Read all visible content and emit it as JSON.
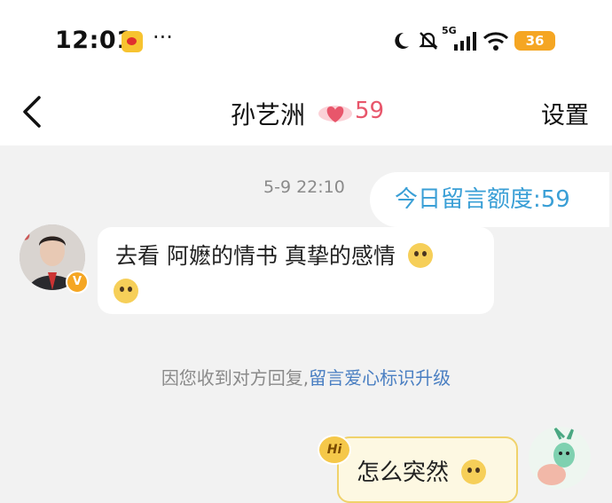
{
  "status_bar": {
    "time": "12:01",
    "more": "···",
    "network": "5G",
    "battery": "36",
    "icons": [
      "weibo-icon",
      "moon-icon",
      "mute-icon",
      "signal-icon",
      "wifi-icon",
      "battery-icon"
    ]
  },
  "nav": {
    "name": "孙艺洲",
    "intimacy": "59",
    "settings": "设置",
    "heart_color": "#e8566b"
  },
  "chat": {
    "timestamp": "5-9 22:10",
    "quota": "今日留言额度:59",
    "incoming_text": "去看 阿嬷的情书 真挚的感情",
    "system_prefix": "因您收到对方回复,",
    "system_link": "留言爱心标识升级",
    "outgoing_text": "怎么突然",
    "hi_badge": "Hi",
    "verify_badge": "V"
  },
  "colors": {
    "accent_blue": "#3a9fd6",
    "link_blue": "#4a7fc2",
    "bubble_out_bg": "#fdf8e2",
    "bubble_out_border": "#f0d26b",
    "chat_bg": "#f2f2f2"
  }
}
